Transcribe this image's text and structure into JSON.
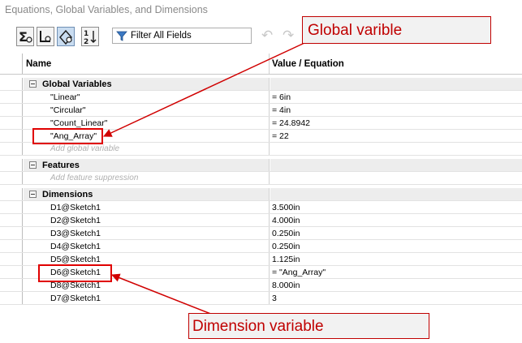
{
  "window": {
    "title": "Equations, Global Variables, and Dimensions"
  },
  "toolbar": {
    "filter_label": "Filter All Fields",
    "icons": [
      "equation-view-icon",
      "global-var-view-icon",
      "dimension-view-icon",
      "ordered-view-icon",
      "funnel-icon",
      "undo-icon",
      "redo-icon"
    ]
  },
  "columns": {
    "name": "Name",
    "value": "Value / Equation"
  },
  "sections": {
    "global": {
      "label": "Global Variables",
      "rows": [
        {
          "name": "\"Linear\"",
          "value": "= 6in"
        },
        {
          "name": "\"Circular\"",
          "value": "= 4in"
        },
        {
          "name": "\"Count_Linear\"",
          "value": "= 24.8942"
        },
        {
          "name": "\"Ang_Array\"",
          "value": "= 22"
        }
      ],
      "add_hint": "Add global variable"
    },
    "features": {
      "label": "Features",
      "add_hint": "Add feature suppression"
    },
    "dimensions": {
      "label": "Dimensions",
      "rows": [
        {
          "name": "D1@Sketch1",
          "value": "3.500in"
        },
        {
          "name": "D2@Sketch1",
          "value": "4.000in"
        },
        {
          "name": "D3@Sketch1",
          "value": "0.250in"
        },
        {
          "name": "D4@Sketch1",
          "value": "0.250in"
        },
        {
          "name": "D5@Sketch1",
          "value": "1.125in"
        },
        {
          "name": "D6@Sketch1",
          "value": "= \"Ang_Array\""
        },
        {
          "name": "D8@Sketch1",
          "value": "8.000in"
        },
        {
          "name": "D7@Sketch1",
          "value": "3"
        }
      ]
    }
  },
  "annotations": {
    "global_callout": "Global varible",
    "dimension_callout": "Dimension variable"
  },
  "colors": {
    "annotation": "#c00000",
    "section_bg": "#ededed"
  }
}
